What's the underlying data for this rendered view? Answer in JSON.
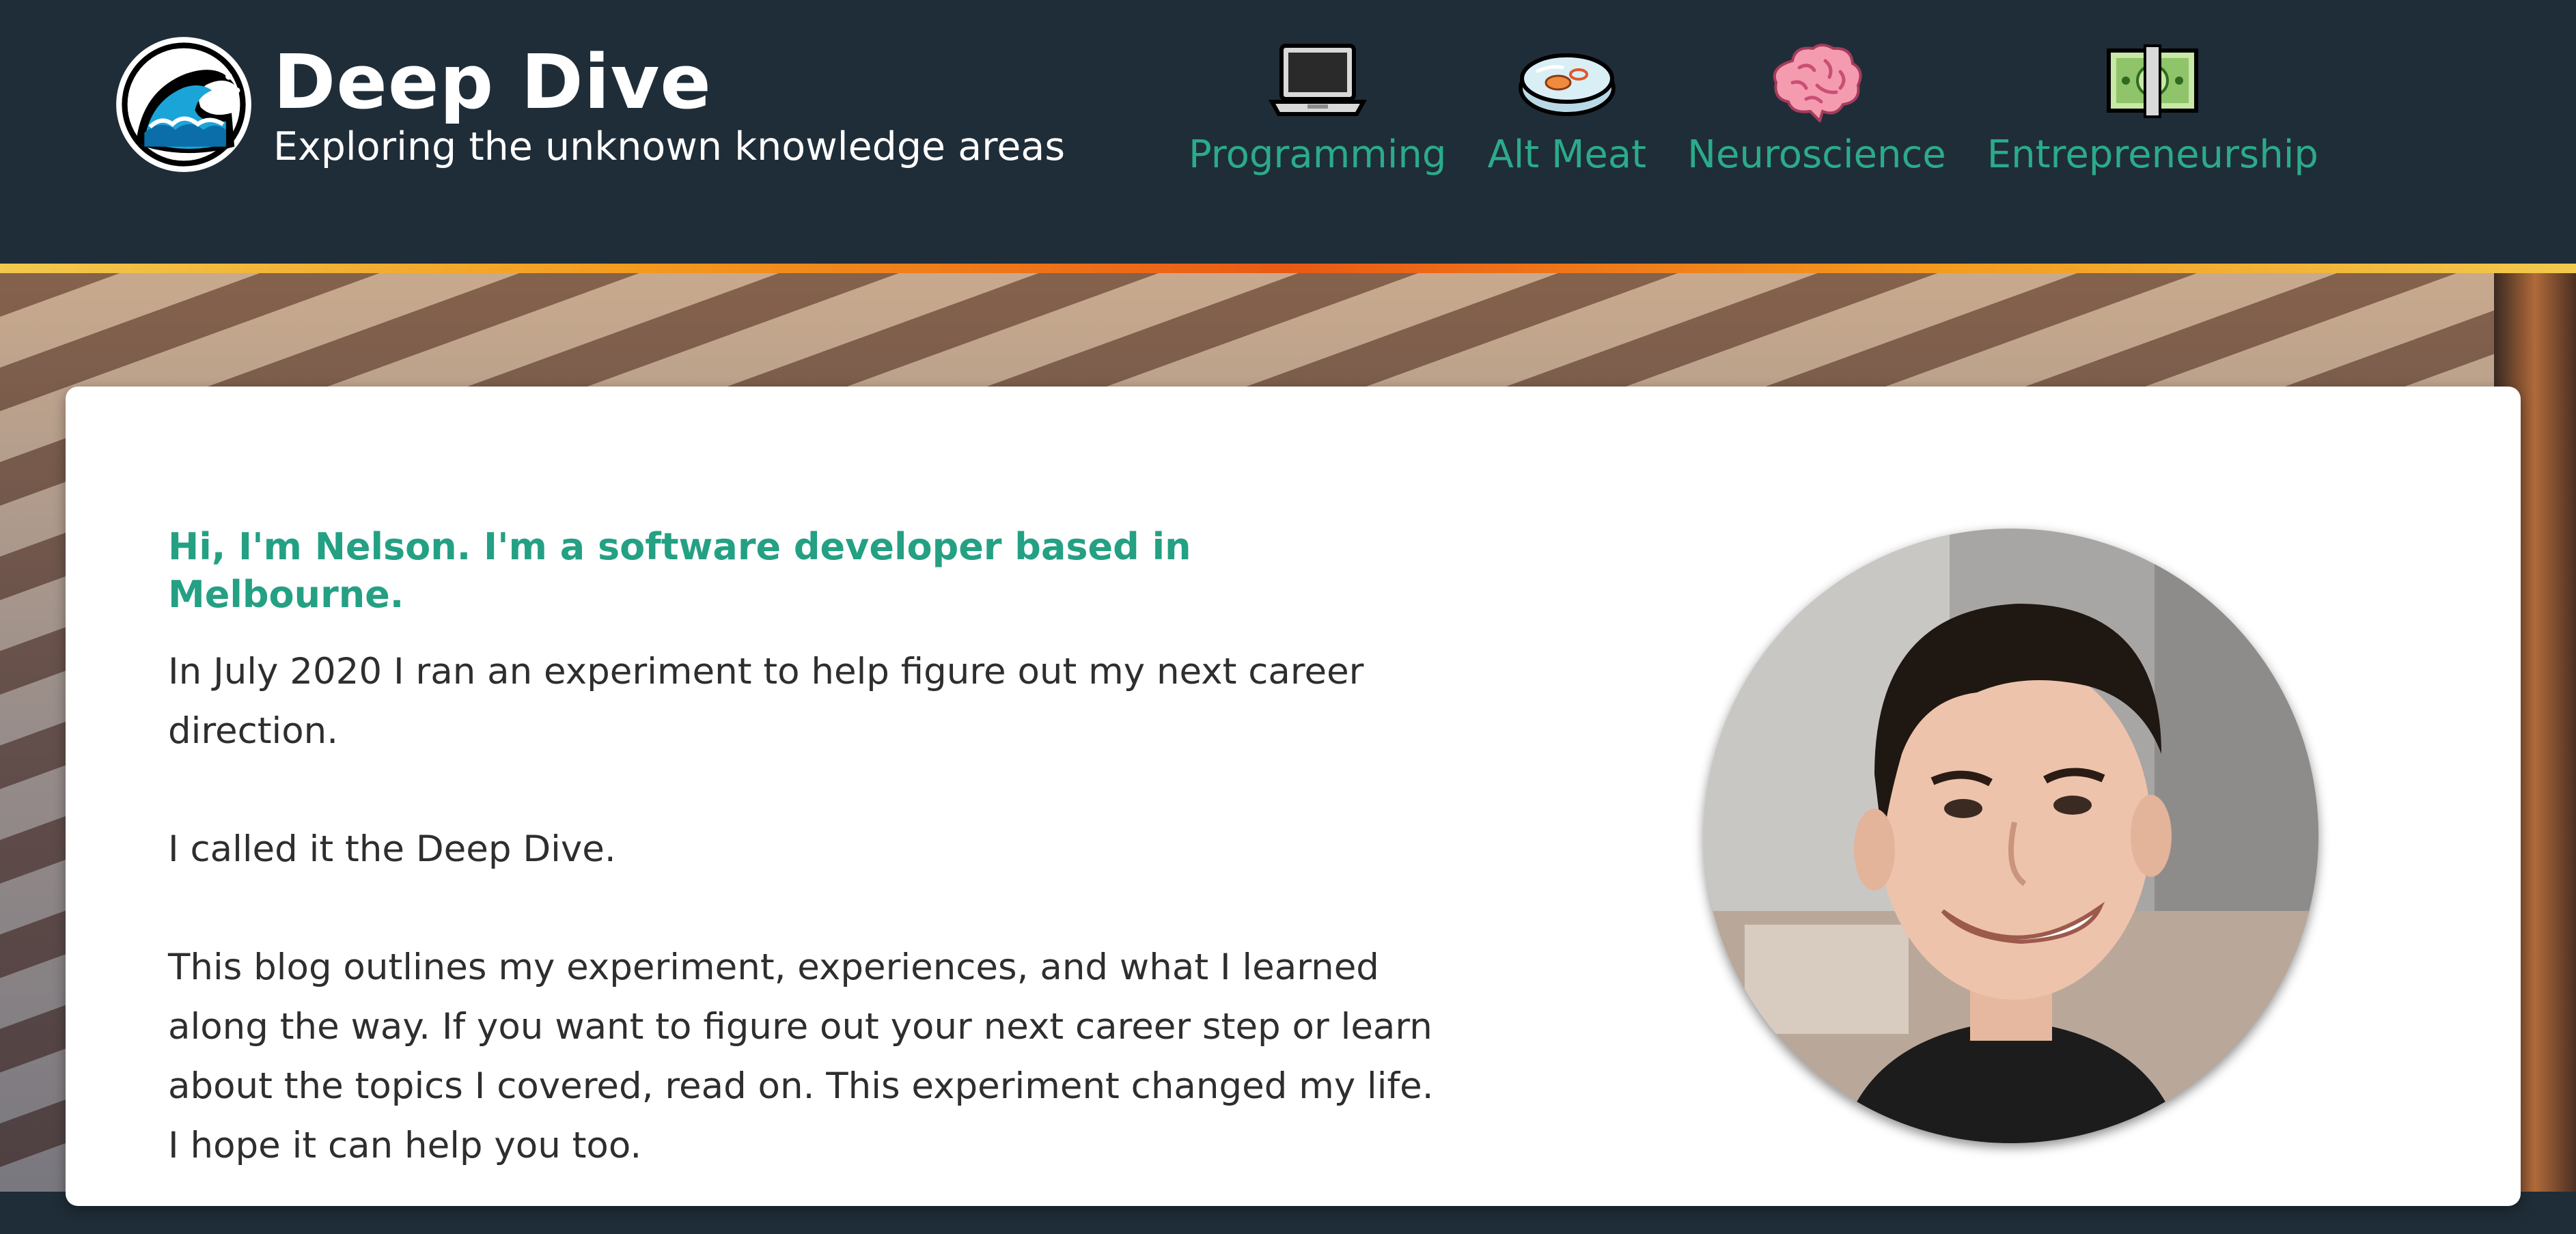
{
  "site": {
    "title": "Deep Dive",
    "tagline": "Exploring the unknown knowledge areas",
    "logo_icon": "wave-icon"
  },
  "nav": {
    "items": [
      {
        "label": "Programming",
        "icon": "laptop-icon"
      },
      {
        "label": "Alt Meat",
        "icon": "petri-dish-icon"
      },
      {
        "label": "Neuroscience",
        "icon": "brain-icon"
      },
      {
        "label": "Entrepreneurship",
        "icon": "dollar-bill-icon"
      }
    ]
  },
  "intro": {
    "heading": "Hi, I'm Nelson. I'm a software developer based in Melbourne.",
    "paragraphs": [
      "In July 2020 I ran an experiment to help figure out my next career direction.",
      "I called it the Deep Dive.",
      "This blog outlines my experiment, experiences, and what I learned along the way. If you want to figure out your next career step or learn about the topics I covered, read on. This experiment changed my life. I hope it can help you too."
    ]
  },
  "colors": {
    "header_bg": "#1f2d38",
    "accent_green": "#2bab8b",
    "heading_green": "#24a083",
    "stripe_orange": "#ea5a14",
    "stripe_yellow": "#f2c94c"
  }
}
